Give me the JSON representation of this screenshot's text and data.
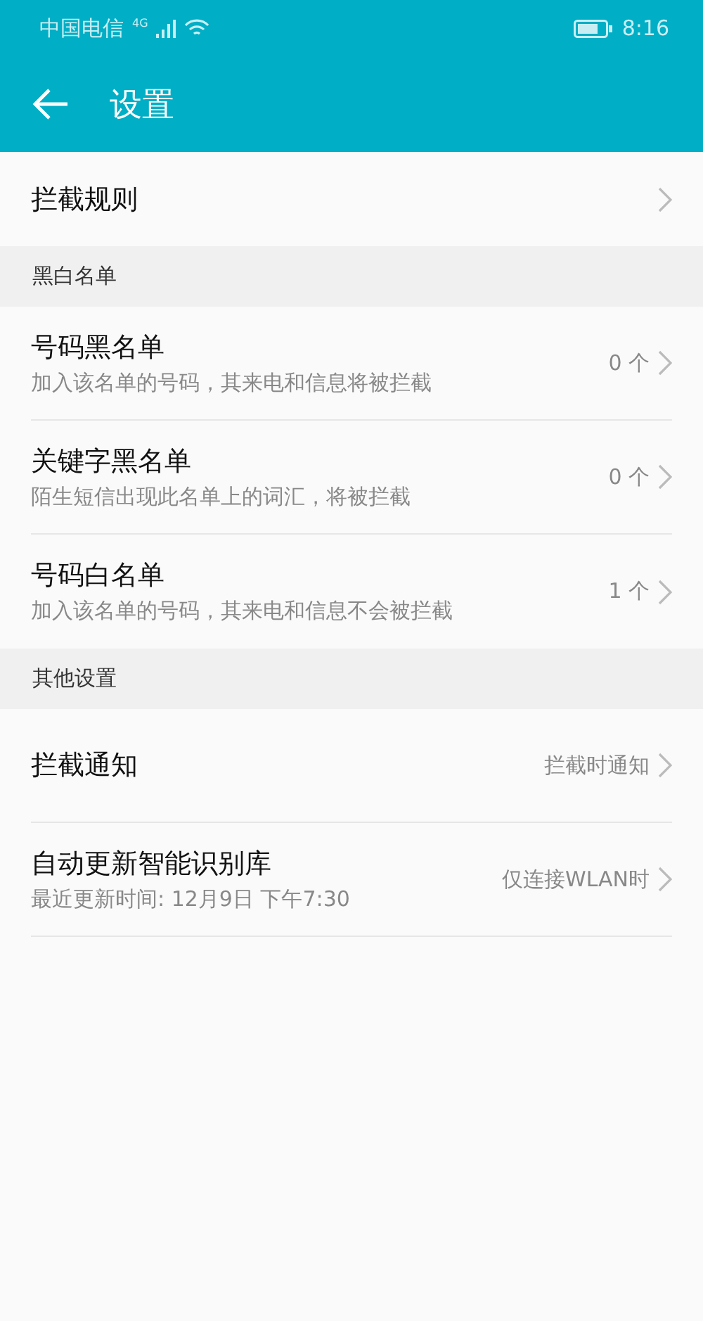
{
  "status_bar": {
    "carrier": "中国电信",
    "network": "4G",
    "time": "8:16"
  },
  "toolbar": {
    "title": "设置"
  },
  "sections": [
    {
      "items": [
        {
          "title": "拦截规则"
        }
      ]
    },
    {
      "header": "黑白名单",
      "items": [
        {
          "title": "号码黑名单",
          "subtitle": "加入该名单的号码，其来电和信息将被拦截",
          "value": "0 个"
        },
        {
          "title": "关键字黑名单",
          "subtitle": "陌生短信出现此名单上的词汇，将被拦截",
          "value": "0 个"
        },
        {
          "title": "号码白名单",
          "subtitle": "加入该名单的号码，其来电和信息不会被拦截",
          "value": "1 个"
        }
      ]
    },
    {
      "header": "其他设置",
      "items": [
        {
          "title": "拦截通知",
          "value": "拦截时通知"
        },
        {
          "title": "自动更新智能识别库",
          "subtitle": "最近更新时间: 12月9日 下午7:30",
          "value": "仅连接WLAN时"
        }
      ]
    }
  ]
}
